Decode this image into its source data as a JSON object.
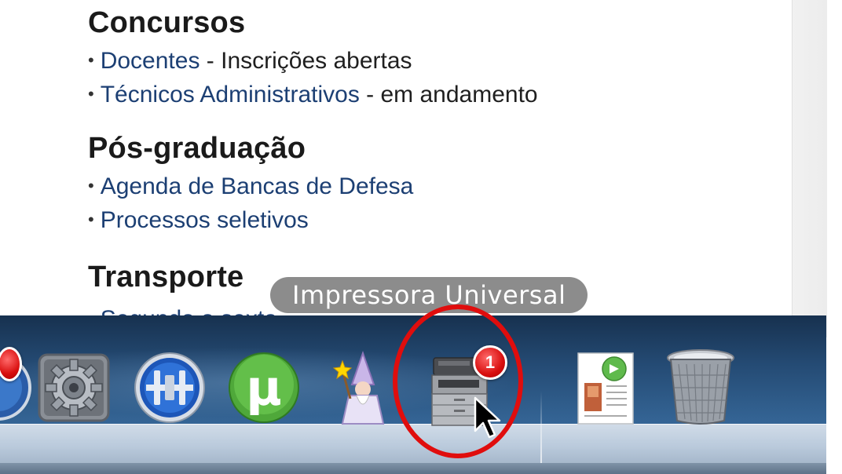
{
  "page": {
    "sections": [
      {
        "id": "concursos",
        "title": "Concursos",
        "items": [
          {
            "link": "Docentes",
            "rest": " - Inscrições abertas"
          },
          {
            "link": "Técnicos Administrativos",
            "rest": " - em andamento"
          }
        ]
      },
      {
        "id": "pos",
        "title": "Pós-graduação",
        "items": [
          {
            "link": "Agenda de Bancas de Defesa",
            "rest": ""
          },
          {
            "link": "Processos seletivos",
            "rest": ""
          }
        ]
      },
      {
        "id": "transporte",
        "title": "Transporte",
        "items": [
          {
            "link": "Segunda a sexta",
            "rest": ""
          }
        ]
      }
    ],
    "bullet": "•"
  },
  "dock": {
    "tooltip": "Impressora Universal",
    "items": [
      {
        "name": "partial-app",
        "badge": ""
      },
      {
        "name": "system-preferences",
        "badge": ""
      },
      {
        "name": "network-utility",
        "badge": ""
      },
      {
        "name": "utorrent",
        "badge": ""
      },
      {
        "name": "wizard-app",
        "badge": ""
      },
      {
        "name": "impressora-universal",
        "badge": "1"
      },
      {
        "name": "document",
        "badge": ""
      },
      {
        "name": "trash",
        "badge": ""
      }
    ],
    "first_badge": "",
    "printer_badge": "1"
  },
  "colors": {
    "link": "#1c3f73",
    "highlight": "#e00d0d",
    "badge": "#d90f0f"
  }
}
